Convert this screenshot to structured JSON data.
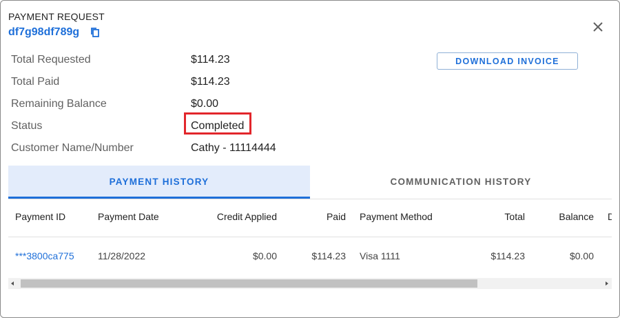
{
  "header": {
    "title": "PAYMENT REQUEST",
    "request_id": "df7g98df789g"
  },
  "icons": {
    "copy": "copy-icon",
    "close": "close-icon"
  },
  "details": {
    "total_requested_label": "Total Requested",
    "total_requested_value": "$114.23",
    "total_paid_label": "Total Paid",
    "total_paid_value": "$114.23",
    "remaining_balance_label": "Remaining Balance",
    "remaining_balance_value": "$0.00",
    "status_label": "Status",
    "status_value": "Completed",
    "customer_label": "Customer Name/Number",
    "customer_value": "Cathy - 11114444"
  },
  "actions": {
    "download_invoice": "DOWNLOAD INVOICE"
  },
  "tabs": [
    {
      "label": "PAYMENT HISTORY",
      "active": true
    },
    {
      "label": "COMMUNICATION HISTORY",
      "active": false
    }
  ],
  "table": {
    "columns": [
      "Payment ID",
      "Payment Date",
      "Credit Applied",
      "Paid",
      "Payment Method",
      "Total",
      "Balance",
      "D"
    ],
    "rows": [
      {
        "payment_id": "***3800ca775",
        "payment_date": "11/28/2022",
        "credit_applied": "$0.00",
        "paid": "$114.23",
        "payment_method": "Visa 1111",
        "total": "$114.23",
        "balance": "$0.00"
      }
    ]
  },
  "colors": {
    "accent": "#1e6fd9",
    "highlight_box": "#e2262b",
    "active_tab_bg": "#e3ecfb"
  }
}
